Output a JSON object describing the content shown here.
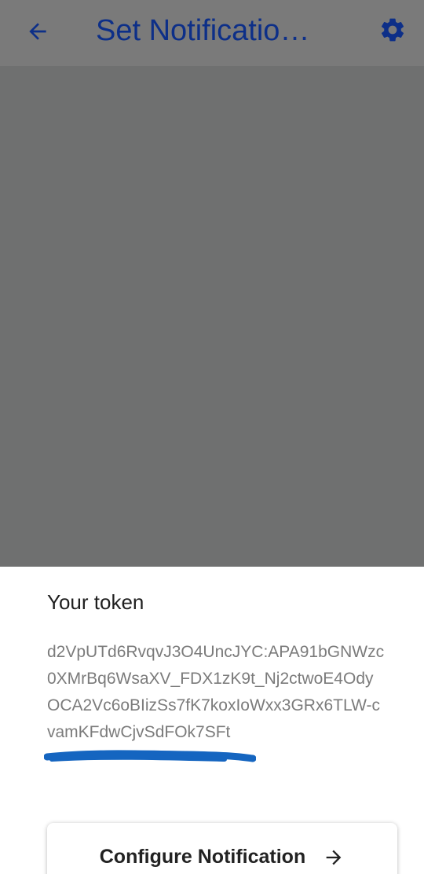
{
  "app_bar": {
    "title": "Set Notificatio…",
    "back_icon": "arrow-back-icon",
    "settings_icon": "gear-icon",
    "title_color": "#0d2f88",
    "background": "#7a7a7a"
  },
  "overlay": {
    "scrim_color": "#6f7070"
  },
  "sheet": {
    "heading": "Your token",
    "token": "d2VpUTd6RvqvJ3O4UncJYC:APA91bGNWzc0XMrBq6WsaXV_FDX1zK9t_Nj2ctwoE4OdyOCA2Vc6oBIizSs7fK7koxIoWxx3GRx6TLW-cvamKFdwCjvSdFOk7SFt",
    "redaction_color": "#1565c0",
    "configure_button": {
      "label": "Configure Notification",
      "icon": "arrow-right-icon"
    }
  }
}
